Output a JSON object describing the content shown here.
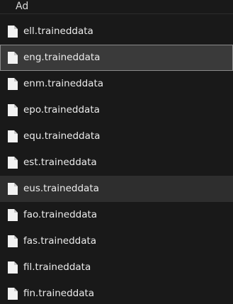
{
  "header": {
    "label": "Ad"
  },
  "files": [
    {
      "name": "ell.traineddata",
      "state": "normal"
    },
    {
      "name": "eng.traineddata",
      "state": "selected"
    },
    {
      "name": "enm.traineddata",
      "state": "normal"
    },
    {
      "name": "epo.traineddata",
      "state": "normal"
    },
    {
      "name": "equ.traineddata",
      "state": "normal"
    },
    {
      "name": "est.traineddata",
      "state": "normal"
    },
    {
      "name": "eus.traineddata",
      "state": "hover"
    },
    {
      "name": "fao.traineddata",
      "state": "normal"
    },
    {
      "name": "fas.traineddata",
      "state": "normal"
    },
    {
      "name": "fil.traineddata",
      "state": "normal"
    },
    {
      "name": "fin.traineddata",
      "state": "normal"
    }
  ],
  "icon": "file-icon",
  "colors": {
    "background": "#191919",
    "selected_background": "#3a3a3a",
    "selected_border": "#8a8a8a",
    "hover_background": "#2e2e2e",
    "text": "#ececec"
  }
}
